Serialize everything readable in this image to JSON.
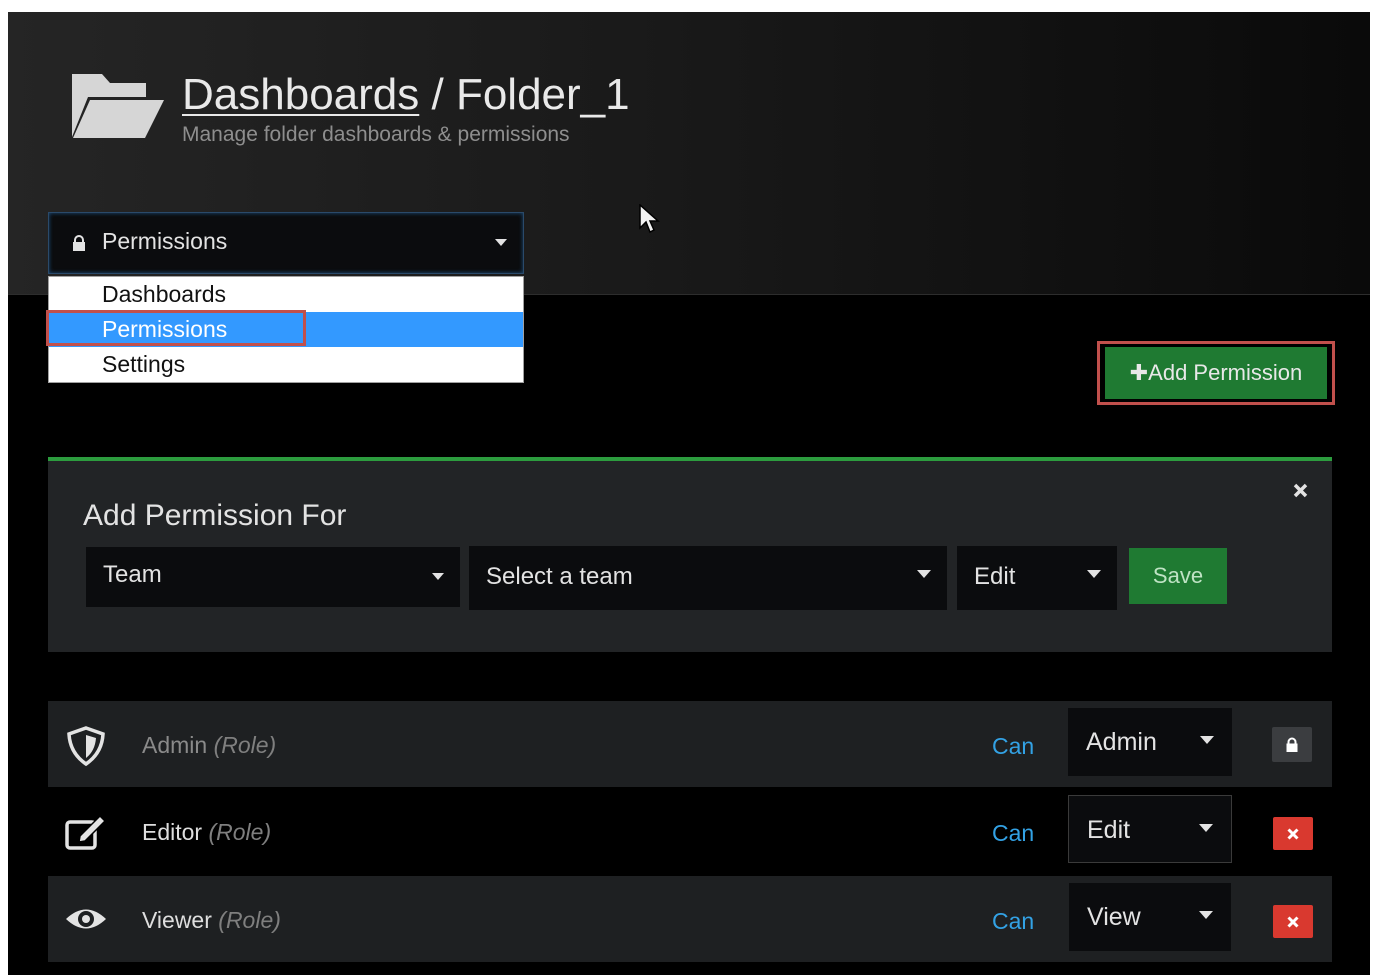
{
  "header": {
    "title_link": "Dashboards",
    "title_separator": " / ",
    "title_folder": "Folder_1",
    "subtitle": "Manage folder dashboards & permissions"
  },
  "nav": {
    "selected": "Permissions",
    "options": [
      "Dashboards",
      "Permissions",
      "Settings"
    ]
  },
  "toolbar": {
    "add_permission_label": "Add Permission"
  },
  "add_panel": {
    "title": "Add Permission For",
    "type_value": "Team",
    "target_placeholder": "Select a team",
    "permission_value": "Edit",
    "save_label": "Save"
  },
  "permissions": [
    {
      "name": "Admin",
      "role": "(Role)",
      "can": "Can",
      "level": "Admin",
      "icon": "shield-icon",
      "action": "lock-icon"
    },
    {
      "name": "Editor",
      "role": "(Role)",
      "can": "Can",
      "level": "Edit",
      "icon": "edit-icon",
      "action": "remove-icon"
    },
    {
      "name": "Viewer",
      "role": "(Role)",
      "can": "Can",
      "level": "View",
      "icon": "eye-icon",
      "action": "remove-icon"
    }
  ],
  "colors": {
    "accent_green": "#2c9c3e",
    "button_green": "#1f7a32",
    "link_blue": "#33a2e5",
    "danger_red": "#d9392f",
    "highlight_red": "#c1504c",
    "selection_blue": "#3399ff"
  }
}
